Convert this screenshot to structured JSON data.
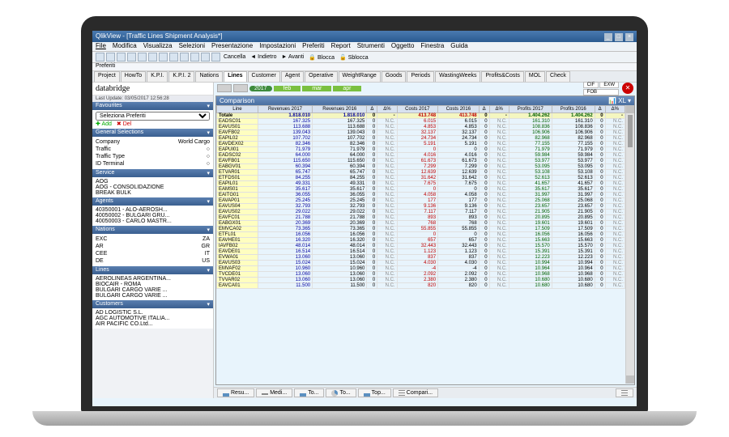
{
  "window": {
    "appTitle": "QlikView - [Traffic Lines Shipment Analysis*]"
  },
  "menu": {
    "items": [
      "File",
      "Modifica",
      "Visualizza",
      "Selezioni",
      "Presentazione",
      "Impostazioni",
      "Preferiti",
      "Report",
      "Strumenti",
      "Oggetto",
      "Finestra",
      "Guida"
    ]
  },
  "toolbar2": {
    "cancella": "Cancella",
    "indietro": "Indietro",
    "avanti": "Avanti",
    "blocca": "Blocca",
    "sblocca": "Sblocca"
  },
  "prefbar": {
    "label": "Preferiti"
  },
  "tabs": {
    "items": [
      "Project",
      "HowTo",
      "K.P.I.",
      "K.P.I. 2",
      "Nations",
      "Lines",
      "Customer",
      "Agent",
      "Operative",
      "WeightRange",
      "Goods",
      "Periods",
      "WastingWeeks",
      "Profits&Costs",
      "MOL",
      "Check"
    ],
    "active": "Lines"
  },
  "sidebar": {
    "logo": "databridge",
    "lastUpdate": "Last Update: 03/05/2017 12:56:28",
    "favourites": {
      "title": "Favourites",
      "placeholder": "Seleziona Preferiti",
      "add": "Add",
      "del": "Del"
    },
    "generalSelections": {
      "title": "General Selections",
      "rows": [
        {
          "label": "Company",
          "value": "World Cargo"
        },
        {
          "label": "Traffic",
          "value": "○"
        },
        {
          "label": "Traffic Type",
          "value": "○"
        },
        {
          "label": "ID Terminal",
          "value": "○"
        }
      ]
    },
    "service": {
      "title": "Service",
      "rows": [
        "AOG",
        "AOG - CONSOLIDAZIONE",
        "BREAK BULK"
      ]
    },
    "agents": {
      "title": "Agents",
      "rows": [
        "40350001 - ALO-AEROSH...",
        "40050002 - BULGARI GRU...",
        "40050003 - CARLO MASTR..."
      ]
    },
    "nations": {
      "title": "Nations",
      "rows": [
        [
          "EXC",
          "ZA",
          ""
        ],
        [
          "AR",
          "GR",
          ""
        ],
        [
          "CEE",
          "IT",
          ""
        ],
        [
          "DE",
          "US",
          ""
        ]
      ]
    },
    "lines": {
      "title": "Lines",
      "rows": [
        "AEROLINEAS ARGENTINA...",
        "BIOCAIR - ROMA",
        "BULGARI CARGO VARIE ...",
        "BULGARI CARGO VARIE ..."
      ]
    },
    "customers": {
      "title": "Customers",
      "rows": [
        "AD LOGISTIC S.L.",
        "AGC AUTOMOTIVE ITALIA...",
        "AIR PACIFIC CO.Ltd..."
      ]
    }
  },
  "monthbar": {
    "year": "2017",
    "months": [
      "feb",
      "mar",
      "apr"
    ],
    "right": [
      "CIF",
      "FOB",
      "EXW"
    ]
  },
  "grid": {
    "title": "Comparison",
    "headers": [
      "Line",
      "Revenues 2017",
      "Revenues 2016",
      "Δ",
      "Δ%",
      "Costs 2017",
      "Costs 2016",
      "Δ",
      "Δ%",
      "Profits 2017",
      "Profits 2016",
      "Δ",
      "Δ%"
    ],
    "totalRow": {
      "code": "Totale",
      "rev17": "1.818.010",
      "rev16": "1.818.010",
      "d1": "0",
      "dp1": "-",
      "c17": "413.748",
      "c16": "413.748",
      "d2": "0",
      "dp2": "-",
      "p17": "1.404.262",
      "p16": "1.404.262",
      "d3": "0",
      "dp3": "-"
    },
    "rows": [
      {
        "code": "EADSC01",
        "rev": "167.325",
        "c": "6.015",
        "p": "161.310"
      },
      {
        "code": "EAVUS01",
        "rev": "113.688",
        "c": "4.853",
        "p": "108.836"
      },
      {
        "code": "EAVFB02",
        "rev": "139.043",
        "c": "32.137",
        "p": "106.906"
      },
      {
        "code": "EAPIL02",
        "rev": "107.702",
        "c": "24.734",
        "p": "82.968"
      },
      {
        "code": "EAVDEX02",
        "rev": "82.346",
        "c": "5.191",
        "p": "77.155"
      },
      {
        "code": "EAPUI01",
        "rev": "71.979",
        "c": "0",
        "p": "71.979"
      },
      {
        "code": "EADSC02",
        "rev": "64.000",
        "c": "4.016",
        "p": "59.984"
      },
      {
        "code": "EAVFB01",
        "rev": "115.650",
        "c": "61.673",
        "p": "53.977"
      },
      {
        "code": "EABGV01",
        "rev": "60.394",
        "c": "7.299",
        "p": "53.095"
      },
      {
        "code": "ETVAR01",
        "rev": "65.747",
        "c": "12.639",
        "p": "53.108"
      },
      {
        "code": "ETFDS01",
        "rev": "84.255",
        "c": "31.642",
        "p": "52.613"
      },
      {
        "code": "EAPIL01",
        "rev": "49.331",
        "c": "7.675",
        "p": "41.657"
      },
      {
        "code": "EAMS01",
        "rev": "35.617",
        "c": "0",
        "p": "35.617"
      },
      {
        "code": "EAITG01",
        "rev": "36.055",
        "c": "4.058",
        "p": "31.997"
      },
      {
        "code": "EAVAP01",
        "rev": "25.245",
        "c": "177",
        "p": "25.068"
      },
      {
        "code": "EAVUS04",
        "rev": "32.793",
        "c": "9.136",
        "p": "23.657"
      },
      {
        "code": "EAVUS02",
        "rev": "29.022",
        "c": "7.117",
        "p": "21.905"
      },
      {
        "code": "EAVFC01",
        "rev": "21.788",
        "c": "893",
        "p": "20.895"
      },
      {
        "code": "EABGX01",
        "rev": "20.369",
        "c": "768",
        "p": "19.601"
      },
      {
        "code": "EMVCA02",
        "rev": "73.365",
        "c": "55.855",
        "p": "17.509"
      },
      {
        "code": "ETFL01",
        "rev": "16.056",
        "c": "0",
        "p": "16.056"
      },
      {
        "code": "EAVHE01",
        "rev": "16.320",
        "c": "657",
        "p": "15.663"
      },
      {
        "code": "IAVFB02",
        "rev": "48.014",
        "c": "32.443",
        "p": "15.570"
      },
      {
        "code": "EAVDE01",
        "rev": "16.514",
        "c": "1.123",
        "p": "15.391"
      },
      {
        "code": "EVWA01",
        "rev": "13.060",
        "c": "837",
        "p": "12.223"
      },
      {
        "code": "EAVUS03",
        "rev": "15.024",
        "c": "4.030",
        "p": "10.994"
      },
      {
        "code": "EMVAF02",
        "rev": "10.960",
        "c": "-4",
        "p": "10.964"
      },
      {
        "code": "TVCDE01",
        "rev": "13.060",
        "c": "2.092",
        "p": "10.968"
      },
      {
        "code": "TVVAR02",
        "rev": "13.060",
        "c": "2.380",
        "p": "10.680"
      },
      {
        "code": "EAVCA01",
        "rev": "11.500",
        "c": "820",
        "p": "10.680"
      }
    ]
  },
  "bottombar": {
    "buttons": [
      "Resu...",
      "Medi...",
      "To...",
      "To...",
      "Top...",
      "Compari..."
    ]
  }
}
